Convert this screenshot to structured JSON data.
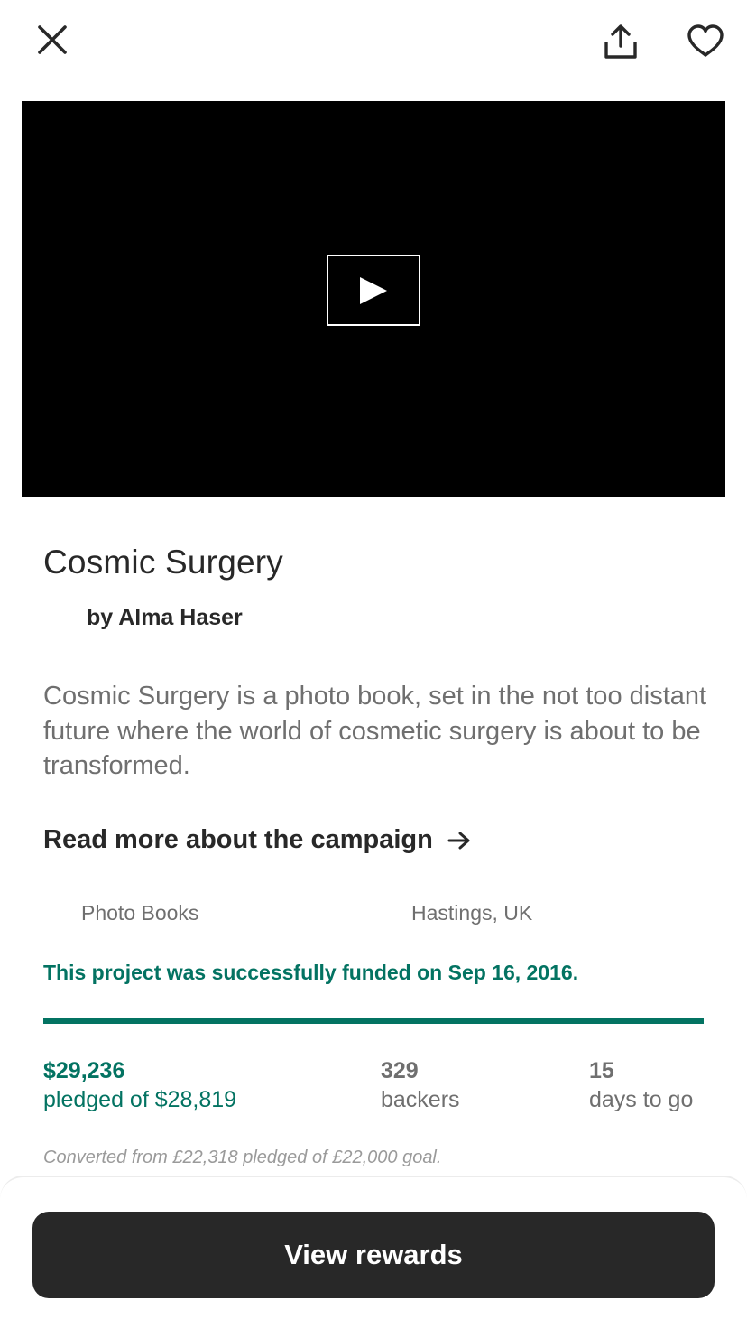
{
  "header": {
    "close_icon": "close-icon",
    "share_icon": "share-icon",
    "favorite_icon": "heart-icon"
  },
  "video": {
    "play_icon": "play-icon"
  },
  "project": {
    "title": "Cosmic Surgery",
    "creator": "by Alma Haser",
    "blurb": "Cosmic Surgery is a photo book, set in the not too distant future where the world of cosmetic surgery is about to be transformed.",
    "read_more": "Read more about the campaign",
    "category": "Photo Books",
    "location": "Hastings, UK"
  },
  "funding": {
    "status_message": "This project was successfully funded on Sep 16, 2016.",
    "progress_fraction": 1.0,
    "pledged_amount": "$29,236",
    "pledged_label": "pledged of $28,819",
    "backers_count": "329",
    "backers_label": "backers",
    "days_count": "15",
    "days_label": "days to go",
    "conversion_note": "Converted from £22,318 pledged of £22,000 goal."
  },
  "footer": {
    "rewards_button": "View rewards"
  },
  "colors": {
    "accent_green": "#037362",
    "text_dark": "#282828",
    "text_muted": "#6f6f6f",
    "button_bg": "#282828"
  }
}
